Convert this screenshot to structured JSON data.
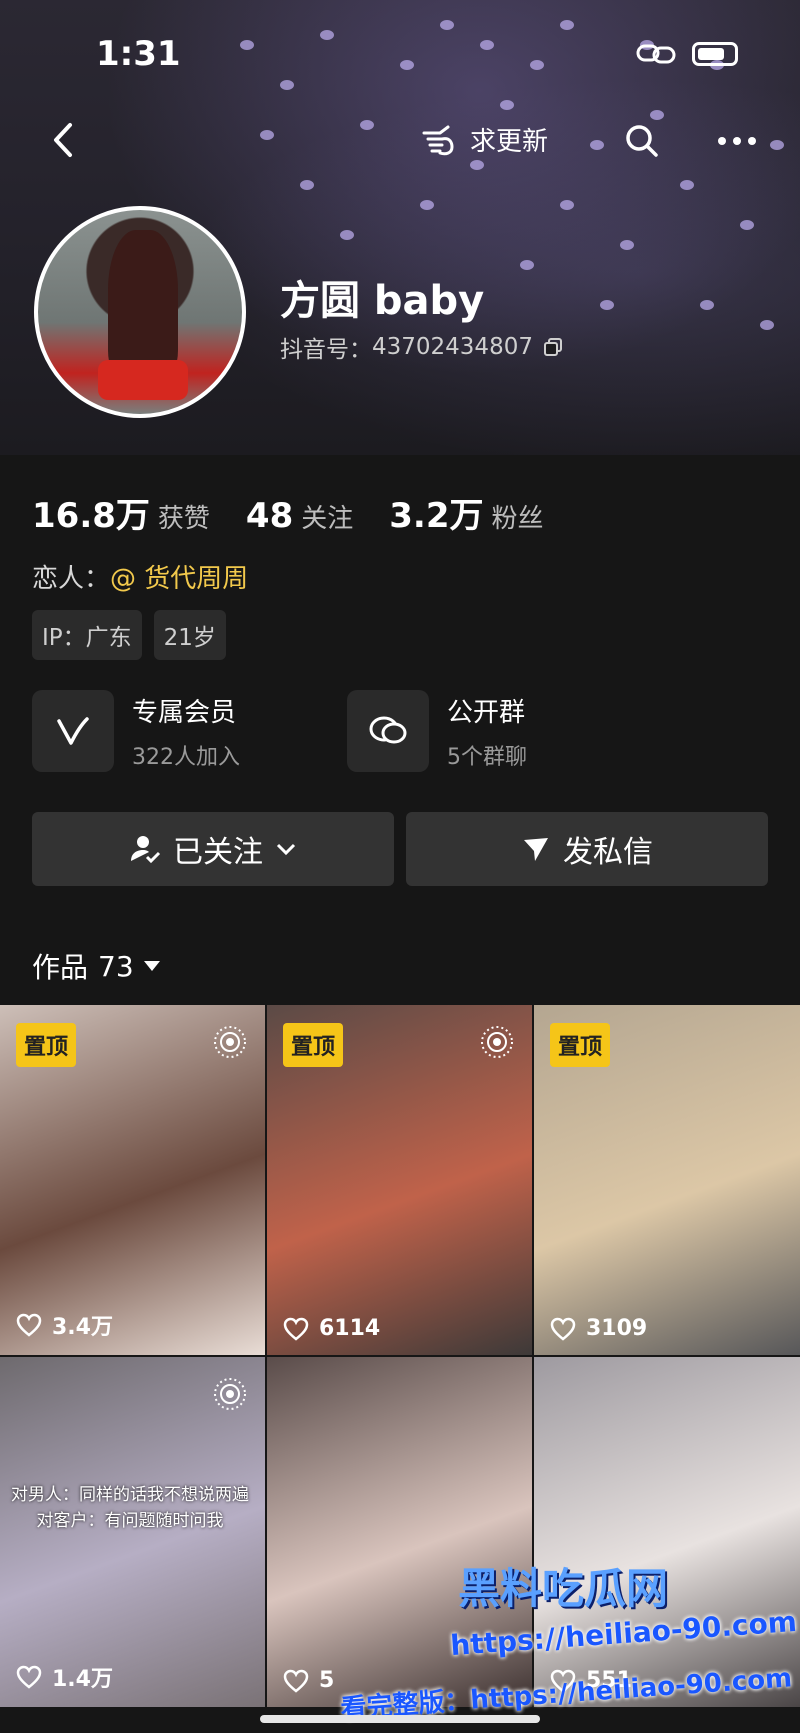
{
  "status_bar": {
    "time": "1:31"
  },
  "top_bar": {
    "request_update_label": "求更新"
  },
  "profile": {
    "name": "方圆 baby",
    "douyin_id_label": "抖音号：",
    "douyin_id": "43702434807"
  },
  "stats": [
    {
      "num": "16.8万",
      "label": "获赞"
    },
    {
      "num": "48",
      "label": "关注"
    },
    {
      "num": "3.2万",
      "label": "粉丝"
    }
  ],
  "lover": {
    "label": "恋人：",
    "value": "@ 货代周周"
  },
  "tags": [
    "IP：广东",
    "21岁"
  ],
  "features": [
    {
      "title": "专属会员",
      "sub": "322人加入",
      "icon": "vip-icon"
    },
    {
      "title": "公开群",
      "sub": "5个群聊",
      "icon": "group-chat-icon"
    }
  ],
  "buttons": {
    "followed": "已关注",
    "message": "发私信"
  },
  "works": {
    "label": "作品",
    "count": "73"
  },
  "grid": [
    {
      "pinned": "置顶",
      "likes": "3.4万",
      "live": true,
      "colors": [
        "#cdbfb8",
        "#6b4a3e",
        "#e9ddd6"
      ]
    },
    {
      "pinned": "置顶",
      "likes": "6114",
      "live": true,
      "colors": [
        "#5b4a46",
        "#c0624a",
        "#3d3938"
      ]
    },
    {
      "pinned": "置顶",
      "likes": "3109",
      "live": false,
      "colors": [
        "#b4a691",
        "#dcc7a6",
        "#575759"
      ]
    },
    {
      "likes": "1.4万",
      "live": true,
      "caption": "对男人：同样的话我不想说两遍 对客户：有问题随时问我",
      "colors": [
        "#6e6a6e",
        "#b6aec4",
        "#7a7276"
      ]
    },
    {
      "likes": "5",
      "colors": [
        "#5a4c4a",
        "#d9c4bd",
        "#3a2f2e"
      ]
    },
    {
      "likes": "551",
      "colors": [
        "#9e9aa0",
        "#e8e2e0",
        "#4a4546"
      ]
    }
  ],
  "watermark": {
    "site": "黑料吃瓜网",
    "url": "https://heiliao-90.com",
    "full_label": "看完整版："
  },
  "colors": {
    "accent_yellow": "#f5c518",
    "lover_gold": "#f2c94c",
    "background": "#161616"
  }
}
